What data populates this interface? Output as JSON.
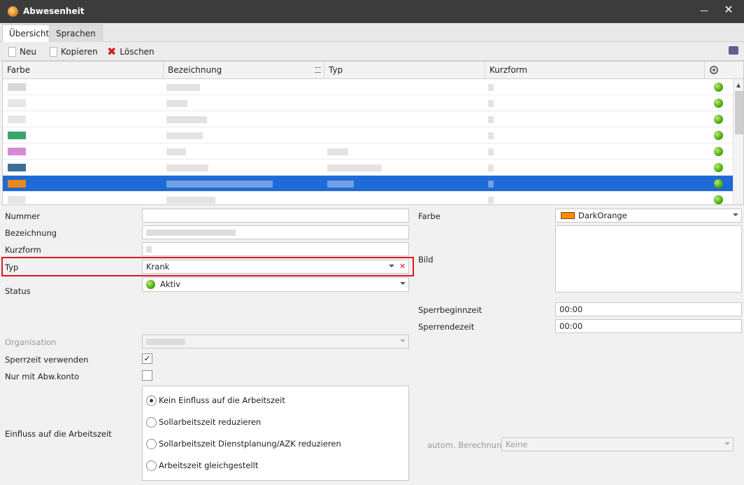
{
  "window": {
    "title": "Abwesenheit",
    "minimize": "—",
    "close": "✕"
  },
  "tabs": [
    "Übersicht",
    "Sprachen"
  ],
  "toolbar": {
    "new_label": "Neu",
    "copy_label": "Kopieren",
    "delete_label": "Löschen"
  },
  "grid": {
    "columns": [
      "Farbe",
      "Bezeichnung",
      "Typ",
      "Kurzform"
    ],
    "rows": [
      {
        "color": "#d8d8d8",
        "selected": false
      },
      {
        "color": "#e6e6e6",
        "selected": false
      },
      {
        "color": "#e6e6e6",
        "selected": false
      },
      {
        "color": "#3aa56b",
        "selected": false
      },
      {
        "color": "#d58ad6",
        "selected": false
      },
      {
        "color": "#3a6f9c",
        "selected": false
      },
      {
        "color": "#e68a1e",
        "selected": true
      },
      {
        "color": "#e6e6e6",
        "selected": false
      }
    ]
  },
  "form": {
    "nummer_label": "Nummer",
    "bezeichnung_label": "Bezeichnung",
    "kurzform_label": "Kurzform",
    "typ_label": "Typ",
    "typ_value": "Krank",
    "status_label": "Status",
    "status_value": "Aktiv",
    "organisation_label": "Organisation",
    "sperrzeit_label": "Sperrzeit verwenden",
    "sperrzeit_checked": true,
    "abwkonto_label": "Nur mit Abw.konto",
    "abwkonto_checked": false,
    "einfluss_label": "Einfluss auf die Arbeitszeit",
    "einfluss_options": [
      "Kein Einfluss auf die Arbeitszeit",
      "Sollarbeitszeit reduzieren",
      "Sollarbeitszeit Dienstplanung/AZK reduzieren",
      "Arbeitszeit gleichgestellt"
    ],
    "einfluss_selected": 0,
    "farbe_label": "Farbe",
    "farbe_value": "DarkOrange",
    "farbe_swatch": "#ff8c00",
    "bild_label": "Bild",
    "sperrbeginn_label": "Sperrbeginnzeit",
    "sperrbeginn_value": "00:00",
    "sperrende_label": "Sperrendezeit",
    "sperrende_value": "00:00",
    "autom_label": "autom. Berechnung",
    "autom_value": "Keine"
  },
  "colors": {
    "selection": "#1e6ad6",
    "highlight": "#d9191f",
    "titlebar": "#3c3c3c"
  }
}
